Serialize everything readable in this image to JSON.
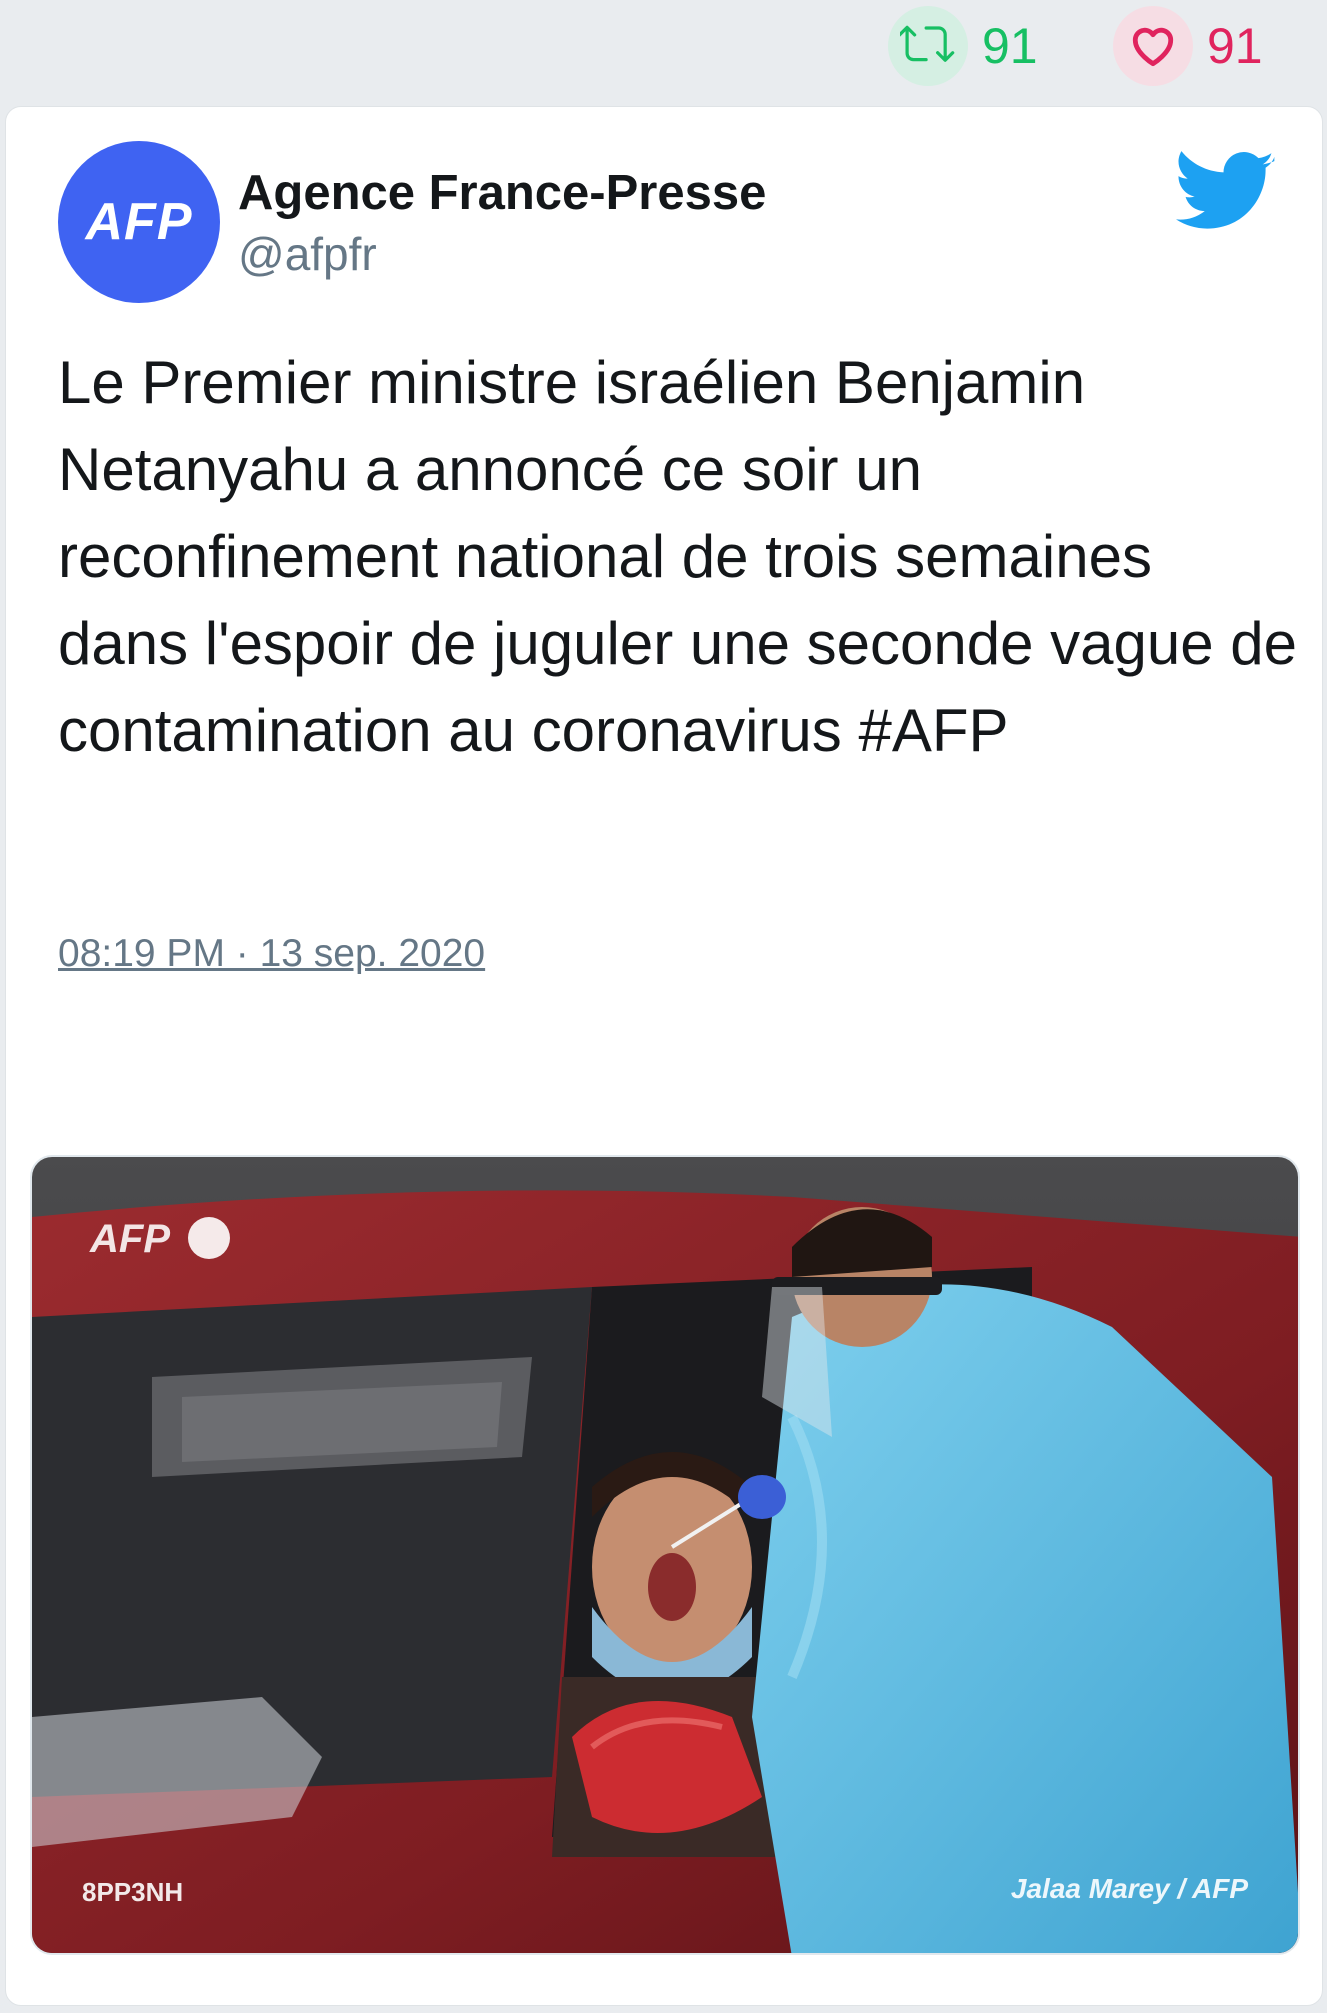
{
  "top_stats": {
    "retweet_count": "91",
    "like_count": "91"
  },
  "tweet": {
    "avatar_text": "AFP",
    "author_name": "Agence France-Presse",
    "author_handle": "@afpfr",
    "text": "Le Premier ministre israélien Benjamin Netanyahu a annoncé ce soir un reconfinement national de trois semaines dans l'espoir de juguler une seconde vague de contamination au coronavirus #AFP",
    "timestamp": "08:19 PM · 13 sep. 2020",
    "actions": [
      "reply",
      "retweet",
      "like"
    ]
  },
  "photo": {
    "watermark_logo": "AFP",
    "code": "8PP3NH",
    "credit": "Jalaa Marey / AFP"
  },
  "colors": {
    "retweet": "#17bf63",
    "like": "#e0245e",
    "twitter_blue": "#1da1f2",
    "avatar_bg": "#3f63f2"
  }
}
